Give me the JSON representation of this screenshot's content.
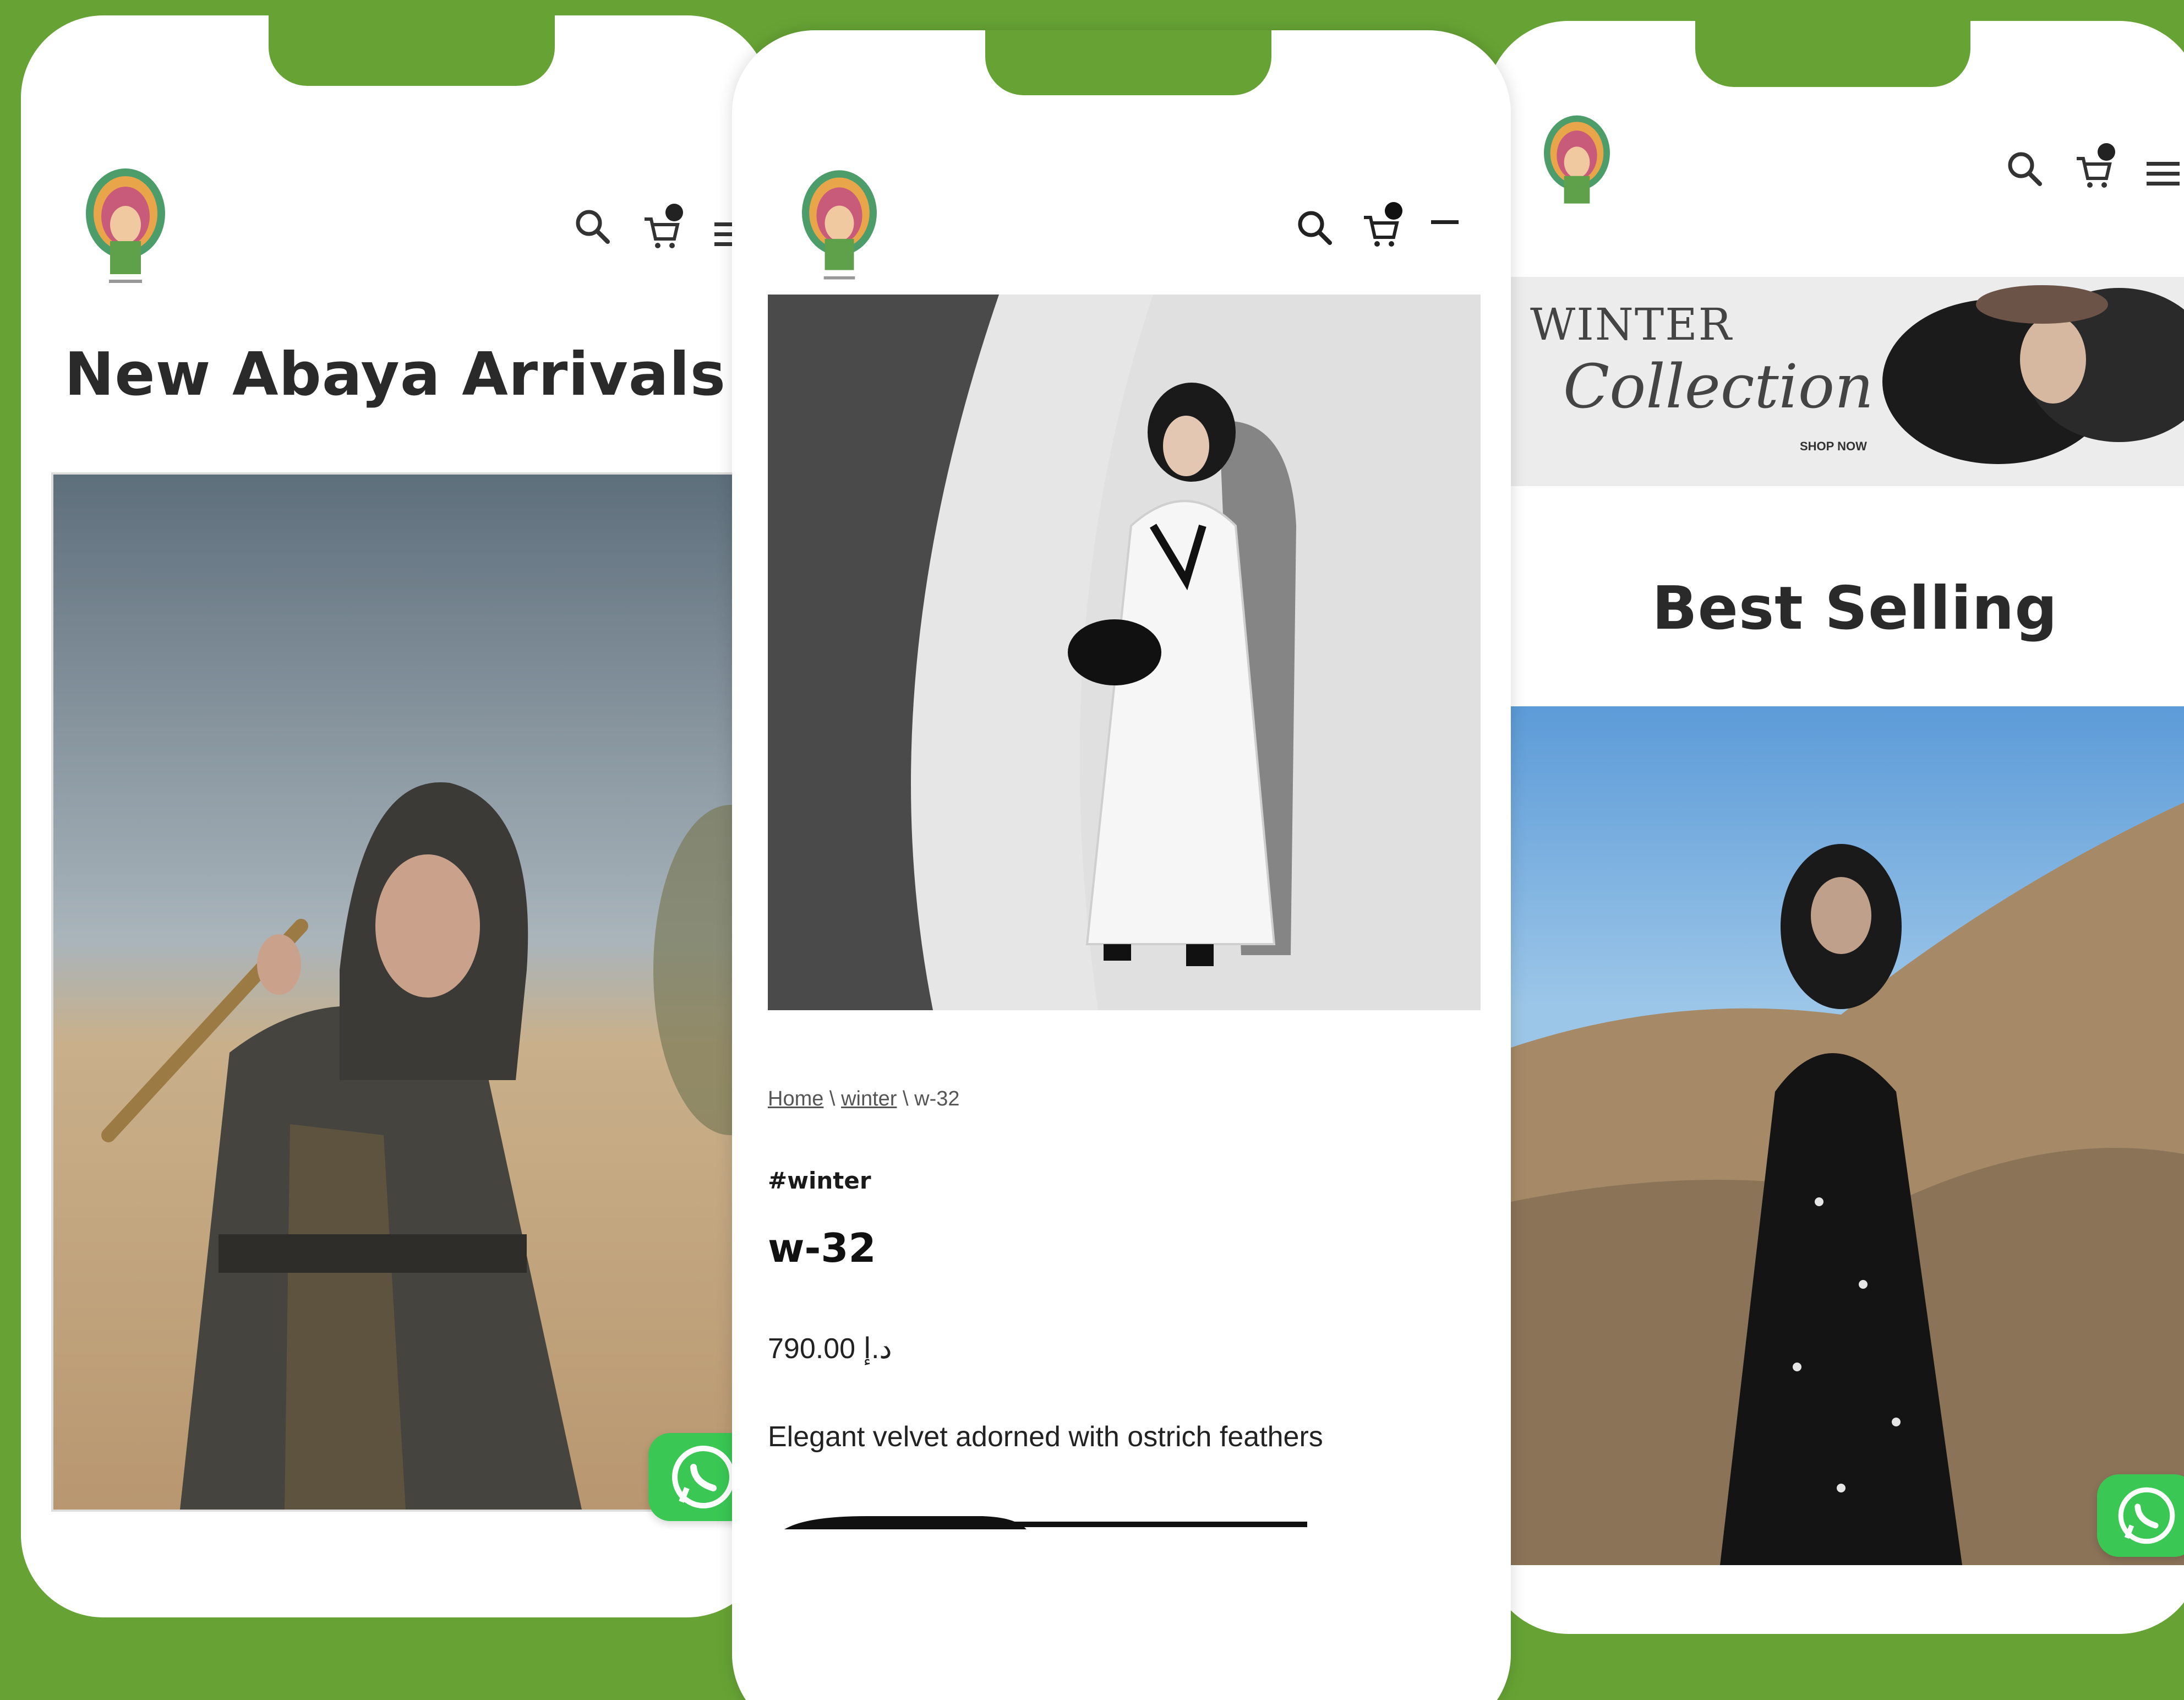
{
  "phones": {
    "left": {
      "header": {
        "logo": "tribal-headdress-logo",
        "icons": [
          "search-icon",
          "cart-icon",
          "menu-icon"
        ]
      },
      "title": "New Abaya Arrivals",
      "image": "woman-in-dark-embroidered-abaya-in-desert-holding-flute",
      "whatsapp": "whatsapp-icon"
    },
    "center": {
      "header": {
        "logo": "tribal-headdress-logo",
        "icons": [
          "search-icon",
          "cart-icon",
          "menu-icon"
        ]
      },
      "image": "model-in-white-abaya-with-black-feather-cuffs",
      "breadcrumb": {
        "home": "Home",
        "sep1": " \\ ",
        "category": "winter",
        "sep2": " \\ ",
        "current": "w-32"
      },
      "tag": "#winter",
      "name": "w-32",
      "price": "790.00 د.إ",
      "description": "Elegant velvet adorned with ostrich feathers"
    },
    "right": {
      "header": {
        "logo": "tribal-headdress-logo",
        "icons": [
          "search-icon",
          "cart-icon",
          "menu-icon"
        ]
      },
      "banner": {
        "line1": "WINTER",
        "line2": "Collection",
        "cta": "SHOP NOW"
      },
      "title": "Best Selling",
      "image": "woman-in-black-abaya-on-rocky-hillside",
      "whatsapp": "whatsapp-icon"
    }
  },
  "colors": {
    "background": "#66a334",
    "whatsapp": "#3ac754"
  }
}
